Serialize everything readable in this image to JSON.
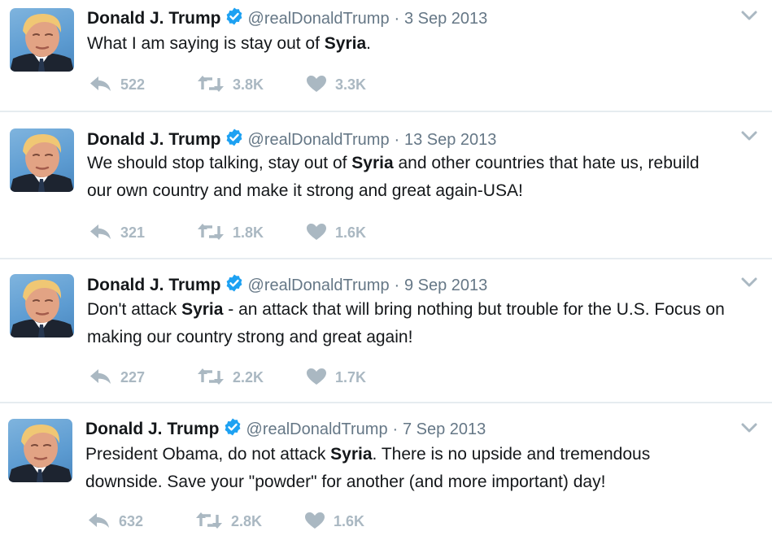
{
  "tweets": [
    {
      "author_name": "Donald J. Trump",
      "handle": "@realDonaldTrump",
      "separator": "·",
      "date": "3 Sep 2013",
      "text_segments": [
        {
          "text": "What I am saying is stay out of ",
          "bold": false
        },
        {
          "text": "Syria",
          "bold": true
        },
        {
          "text": ".",
          "bold": false
        }
      ],
      "replies": "522",
      "retweets": "3.8K",
      "likes": "3.3K"
    },
    {
      "author_name": "Donald J. Trump",
      "handle": "@realDonaldTrump",
      "separator": "·",
      "date": "13 Sep 2013",
      "text_segments": [
        {
          "text": "We should stop talking, stay out of ",
          "bold": false
        },
        {
          "text": "Syria",
          "bold": true
        },
        {
          "text": " and other countries that hate us, rebuild our own country and make it strong and great again-USA!",
          "bold": false
        }
      ],
      "replies": "321",
      "retweets": "1.8K",
      "likes": "1.6K"
    },
    {
      "author_name": "Donald J. Trump",
      "handle": "@realDonaldTrump",
      "separator": "·",
      "date": "9 Sep 2013",
      "text_segments": [
        {
          "text": "Don't attack ",
          "bold": false
        },
        {
          "text": "Syria",
          "bold": true
        },
        {
          "text": " - an attack that will bring nothing but trouble for the U.S. Focus on making our country strong and great again!",
          "bold": false
        }
      ],
      "replies": "227",
      "retweets": "2.2K",
      "likes": "1.7K"
    },
    {
      "author_name": "Donald J. Trump",
      "handle": "@realDonaldTrump",
      "separator": "·",
      "date": "7 Sep 2013",
      "text_segments": [
        {
          "text": "President Obama, do not attack ",
          "bold": false
        },
        {
          "text": "Syria",
          "bold": true
        },
        {
          "text": ". There is no upside and tremendous downside. Save your \"powder\" for another (and more important) day!",
          "bold": false
        }
      ],
      "replies": "632",
      "retweets": "2.8K",
      "likes": "1.6K"
    }
  ],
  "icons": {
    "avatar": "profile-photo",
    "verified": "verified-badge-icon",
    "caret": "chevron-down-icon",
    "reply": "reply-icon",
    "retweet": "retweet-icon",
    "like": "heart-icon"
  },
  "colors": {
    "verified_blue": "#1da1f2",
    "secondary_text": "#657786",
    "action_gray": "#aab8c2",
    "divider": "#e6ecf0"
  }
}
